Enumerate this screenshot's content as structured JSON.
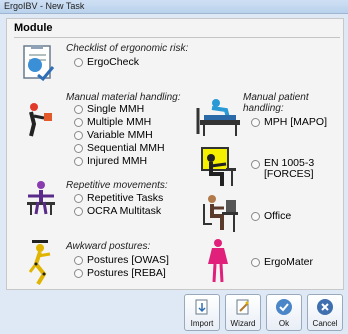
{
  "window": {
    "title": "ErgoIBV - New Task"
  },
  "module": {
    "title": "Module"
  },
  "checklist": {
    "label": "Checklist of ergonomic risk:",
    "option": "ErgoCheck"
  },
  "mmh": {
    "label": "Manual material handling:",
    "options": [
      "Single MMH",
      "Multiple MMH",
      "Variable MMH",
      "Sequential MMH",
      "Injured MMH"
    ]
  },
  "repetitive": {
    "label": "Repetitive movements:",
    "options": [
      "Repetitive Tasks",
      "OCRA Multitask"
    ]
  },
  "awkward": {
    "label": "Awkward postures:",
    "options": [
      "Postures [OWAS]",
      "Postures [REBA]"
    ]
  },
  "patient": {
    "label": "Manual patient handling:",
    "option": "MPH [MAPO]"
  },
  "forces": {
    "option_line1": "EN 1005-3",
    "option_line2": "[FORCES]"
  },
  "office": {
    "option": "Office"
  },
  "ergomater": {
    "option": "ErgoMater"
  },
  "buttons": {
    "import": "Import",
    "wizard": "Wizard",
    "ok": "Ok",
    "cancel": "Cancel"
  },
  "colors": {
    "ok_blue": "#4a86c8",
    "cancel_blue": "#3f6fae",
    "window_bg": "#dfe9f5"
  }
}
